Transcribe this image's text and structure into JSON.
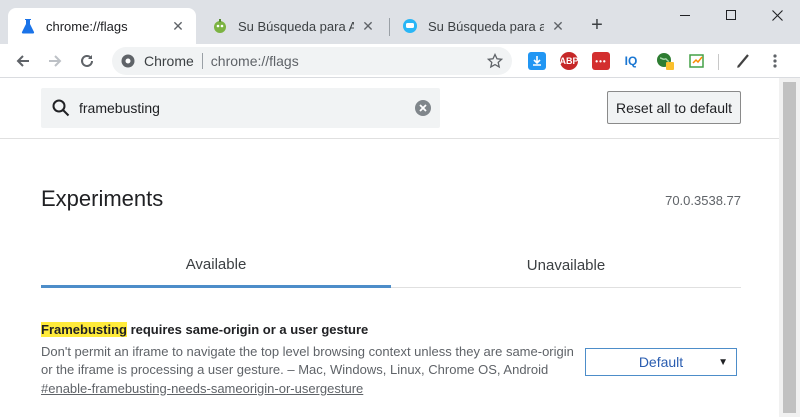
{
  "tabs": [
    {
      "title": "chrome://flags",
      "active": true
    },
    {
      "title": "Su Búsqueda para AdBl",
      "active": false
    },
    {
      "title": "Su Búsqueda para adbl",
      "active": false
    }
  ],
  "omnibox": {
    "chip": "Chrome",
    "url": "chrome://flags"
  },
  "extensions": {
    "abp_label": "ABP",
    "iq_label": "IQ"
  },
  "search": {
    "value": "framebusting"
  },
  "reset_button": "Reset all to default",
  "page_title": "Experiments",
  "version": "70.0.3538.77",
  "page_tabs": {
    "available": "Available",
    "unavailable": "Unavailable"
  },
  "flag": {
    "title_highlight": "Framebusting",
    "title_rest": " requires same-origin or a user gesture",
    "description": "Don't permit an iframe to navigate the top level browsing context unless they are same-origin or the iframe is processing a user gesture. – Mac, Windows, Linux, Chrome OS, Android",
    "link": "#enable-framebusting-needs-sameorigin-or-usergesture",
    "selected": "Default"
  },
  "colors": {
    "accent": "#4d8dc9",
    "highlight": "#ffeb3b",
    "tabstrip": "#dee1e6"
  }
}
